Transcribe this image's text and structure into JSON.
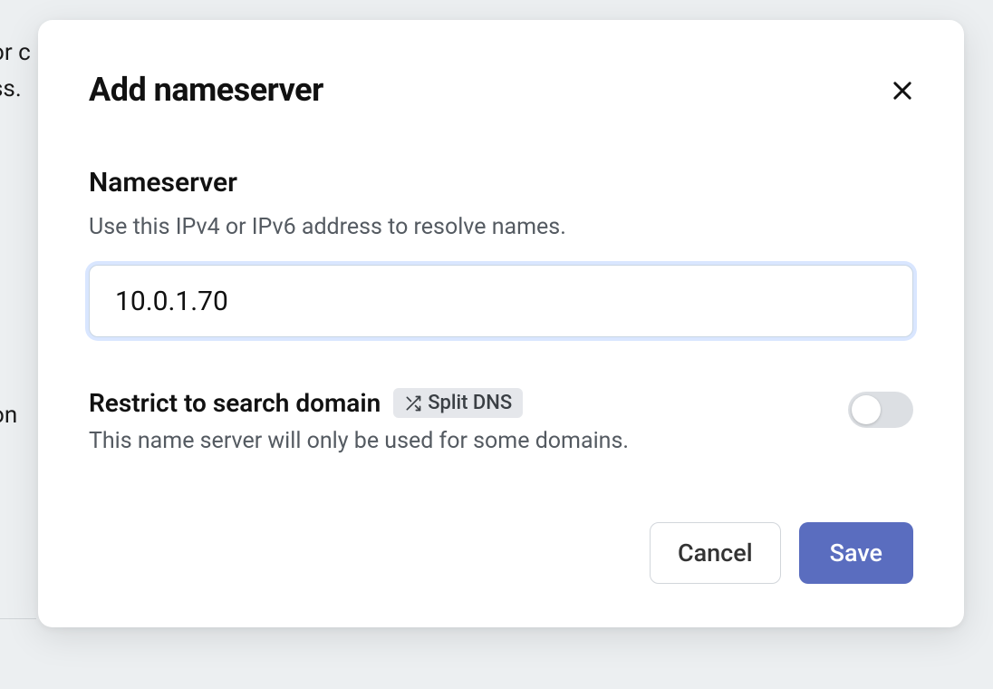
{
  "background": {
    "line1": "or c",
    "line2": "ss.",
    "line3": "on"
  },
  "modal": {
    "title": "Add nameserver",
    "nameserver": {
      "label": "Nameserver",
      "help": "Use this IPv4 or IPv6 address to resolve names.",
      "value": "10.0.1.70"
    },
    "restrict": {
      "title": "Restrict to search domain",
      "badge": "Split DNS",
      "desc": "This name server will only be used for some domains.",
      "enabled": false
    },
    "footer": {
      "cancel": "Cancel",
      "save": "Save"
    }
  }
}
